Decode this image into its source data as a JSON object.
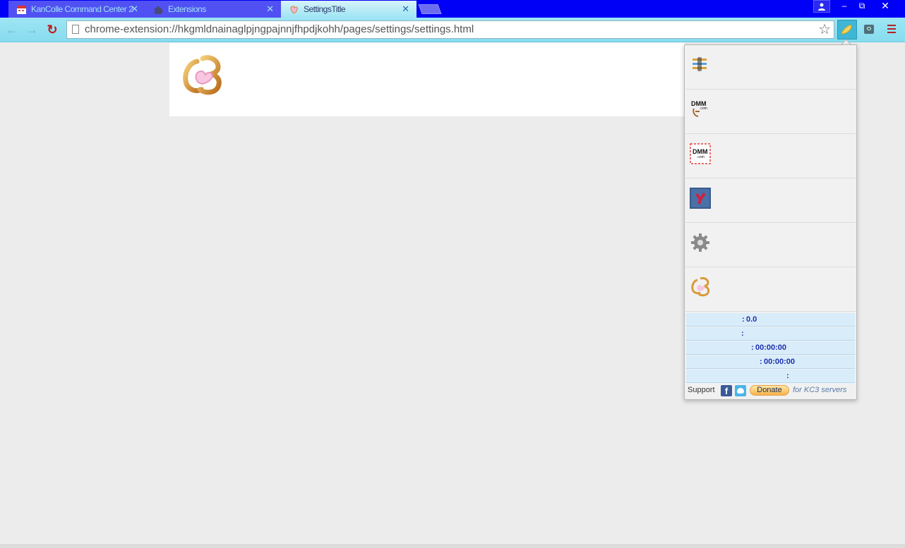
{
  "tabs": [
    {
      "label": "KanColle Command Center 2",
      "icon": "kc3-calendar-icon",
      "active": false
    },
    {
      "label": "Extensions",
      "icon": "puzzle-icon",
      "active": false
    },
    {
      "label": "SettingsTitle",
      "icon": "kc3-logo-icon",
      "active": true
    }
  ],
  "tab_close": "✕",
  "window_controls": {
    "minimize": "‒",
    "restore": "⧉",
    "close": "✕"
  },
  "address_bar": {
    "url": "chrome-extension://hkgmldnainaglpjngpajnnjfhpdjkohh/pages/settings/settings.html"
  },
  "popup": {
    "items": [
      {
        "name": "strategy-room",
        "icon": "strategy-room-icon"
      },
      {
        "name": "dmm-play",
        "icon": "dmm-play-icon"
      },
      {
        "name": "dmm-frame",
        "icon": "dmm-frame-icon"
      },
      {
        "name": "database",
        "icon": "kancolle-db-icon"
      },
      {
        "name": "settings",
        "icon": "gear-icon"
      },
      {
        "name": "about",
        "icon": "kc3-logo-icon"
      }
    ],
    "stats": [
      {
        "label": ":",
        "value": "0.0"
      },
      {
        "label": ":",
        "value": ""
      },
      {
        "label": ":",
        "value": "00:00:00"
      },
      {
        "label": ":",
        "value": "00:00:00"
      },
      {
        "label": ":",
        "value": ""
      }
    ],
    "footer": {
      "support": "Support",
      "facebook": "f",
      "donate": "Donate",
      "note": "for KC3 servers"
    }
  },
  "colors": {
    "tabstrip": "#0000f6",
    "toolbar": "#9ee5f4",
    "page_bg": "#ececec",
    "stat_text": "#1b2fb0"
  }
}
